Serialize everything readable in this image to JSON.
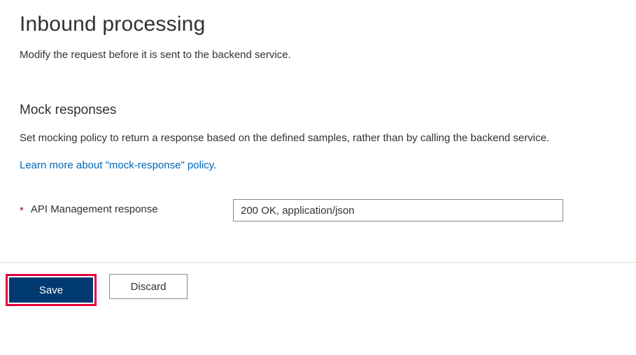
{
  "header": {
    "title": "Inbound processing",
    "subtitle": "Modify the request before it is sent to the backend service."
  },
  "mock": {
    "section_title": "Mock responses",
    "description": "Set mocking policy to return a response based on the defined samples, rather than by calling the backend service.",
    "learn_more": "Learn more about \"mock-response\" policy.",
    "field_label": "API Management response",
    "required_mark": "*",
    "selected_value": "200 OK, application/json"
  },
  "buttons": {
    "save": "Save",
    "discard": "Discard"
  }
}
